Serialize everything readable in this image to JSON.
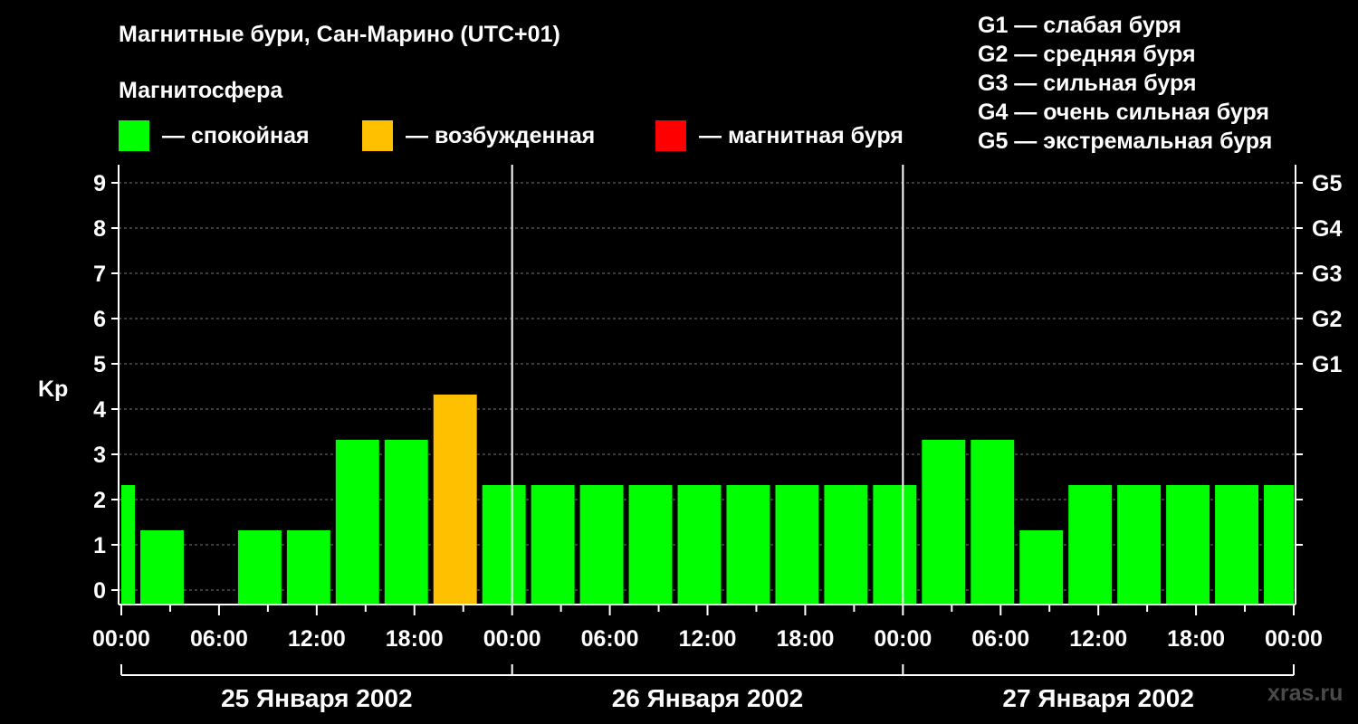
{
  "title": "Магнитные бури, Сан-Марино (UTC+01)",
  "subtitle": "Магнитосфера",
  "legend": [
    {
      "label": "— спокойная",
      "color": "#00ff00"
    },
    {
      "label": "— возбужденная",
      "color": "#ffc000"
    },
    {
      "label": "— магнитная буря",
      "color": "#ff0000"
    }
  ],
  "storm_scale": [
    "G1 — слабая буря",
    "G2 — средняя буря",
    "G3 — сильная буря",
    "G4 — очень сильная буря",
    "G5 — экстремальная буря"
  ],
  "watermark": "xras.ru",
  "chart_data": {
    "type": "bar",
    "ylabel": "Kp",
    "ylim": [
      0,
      9
    ],
    "yticks": [
      "0",
      "1",
      "2",
      "3",
      "4",
      "5",
      "6",
      "7",
      "8",
      "9"
    ],
    "right_ticks": [
      {
        "y": 5,
        "label": "G1"
      },
      {
        "y": 6,
        "label": "G2"
      },
      {
        "y": 7,
        "label": "G3"
      },
      {
        "y": 8,
        "label": "G4"
      },
      {
        "y": 9,
        "label": "G5"
      }
    ],
    "xlim_hours": [
      0,
      72
    ],
    "xtick_labels": [
      "00:00",
      "06:00",
      "12:00",
      "18:00",
      "00:00",
      "06:00",
      "12:00",
      "18:00",
      "00:00",
      "06:00",
      "12:00",
      "18:00",
      "00:00"
    ],
    "day_labels": [
      "25 Января 2002",
      "26 Января 2002",
      "27 Января 2002"
    ],
    "grid": "dashed horizontal at each integer Kp",
    "bars": [
      {
        "start_hour": 0,
        "end_hour": 1,
        "kp": 2,
        "status": "quiet"
      },
      {
        "start_hour": 1,
        "end_hour": 4,
        "kp": 1,
        "status": "quiet"
      },
      {
        "start_hour": 4,
        "end_hour": 7,
        "kp": 0,
        "status": "quiet"
      },
      {
        "start_hour": 7,
        "end_hour": 10,
        "kp": 1,
        "status": "quiet"
      },
      {
        "start_hour": 10,
        "end_hour": 13,
        "kp": 1,
        "status": "quiet"
      },
      {
        "start_hour": 13,
        "end_hour": 16,
        "kp": 3,
        "status": "quiet"
      },
      {
        "start_hour": 16,
        "end_hour": 19,
        "kp": 3,
        "status": "quiet"
      },
      {
        "start_hour": 19,
        "end_hour": 22,
        "kp": 4,
        "status": "excited"
      },
      {
        "start_hour": 22,
        "end_hour": 25,
        "kp": 2,
        "status": "quiet"
      },
      {
        "start_hour": 25,
        "end_hour": 28,
        "kp": 2,
        "status": "quiet"
      },
      {
        "start_hour": 28,
        "end_hour": 31,
        "kp": 2,
        "status": "quiet"
      },
      {
        "start_hour": 31,
        "end_hour": 34,
        "kp": 2,
        "status": "quiet"
      },
      {
        "start_hour": 34,
        "end_hour": 37,
        "kp": 2,
        "status": "quiet"
      },
      {
        "start_hour": 37,
        "end_hour": 40,
        "kp": 2,
        "status": "quiet"
      },
      {
        "start_hour": 40,
        "end_hour": 43,
        "kp": 2,
        "status": "quiet"
      },
      {
        "start_hour": 43,
        "end_hour": 46,
        "kp": 2,
        "status": "quiet"
      },
      {
        "start_hour": 46,
        "end_hour": 49,
        "kp": 2,
        "status": "quiet"
      },
      {
        "start_hour": 49,
        "end_hour": 52,
        "kp": 3,
        "status": "quiet"
      },
      {
        "start_hour": 52,
        "end_hour": 55,
        "kp": 3,
        "status": "quiet"
      },
      {
        "start_hour": 55,
        "end_hour": 58,
        "kp": 1,
        "status": "quiet"
      },
      {
        "start_hour": 58,
        "end_hour": 61,
        "kp": 2,
        "status": "quiet"
      },
      {
        "start_hour": 61,
        "end_hour": 64,
        "kp": 2,
        "status": "quiet"
      },
      {
        "start_hour": 64,
        "end_hour": 67,
        "kp": 2,
        "status": "quiet"
      },
      {
        "start_hour": 67,
        "end_hour": 70,
        "kp": 2,
        "status": "quiet"
      },
      {
        "start_hour": 70,
        "end_hour": 72,
        "kp": 2,
        "status": "quiet"
      }
    ],
    "status_colors": {
      "quiet": "#00ff00",
      "excited": "#ffc000",
      "storm": "#ff0000"
    }
  }
}
